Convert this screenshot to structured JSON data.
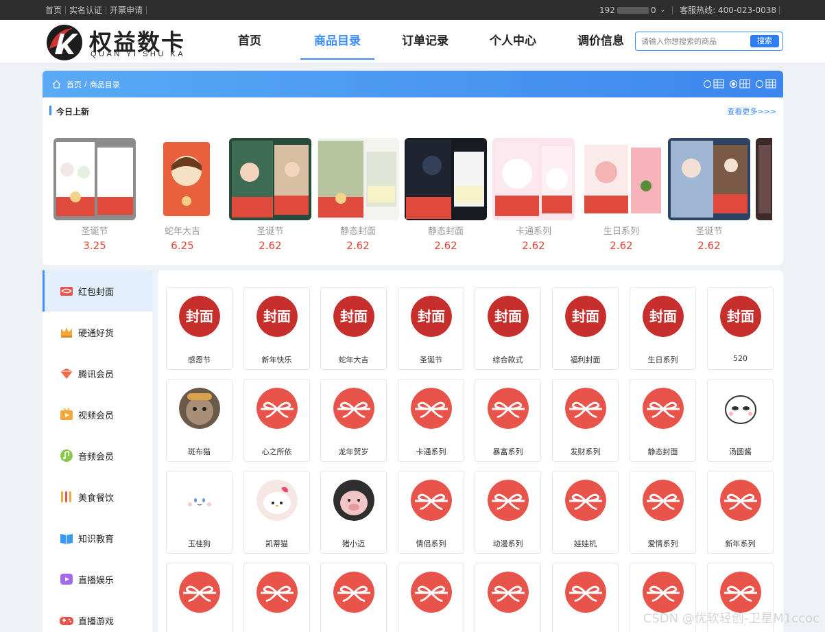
{
  "topbar": {
    "links": [
      "首页",
      "实名认证",
      "开票申请"
    ],
    "phone_prefix": "192",
    "phone_suffix": "0",
    "hotline": "客服热线: 400-023-0038"
  },
  "logo": {
    "title": "权益数卡",
    "subtitle": "QUAN YI SHU KA"
  },
  "nav": [
    "首页",
    "商品目录",
    "订单记录",
    "个人中心",
    "调价信息"
  ],
  "search": {
    "placeholder": "请输入你想搜索的商品",
    "button": "搜索"
  },
  "breadcrumb": {
    "home": "首页",
    "sep": "/",
    "current": "商品目录"
  },
  "today_new": {
    "title": "今日上新",
    "more": "查看更多>>>",
    "items": [
      {
        "name": "圣诞节",
        "price": "3.25"
      },
      {
        "name": "蛇年大吉",
        "price": "6.25"
      },
      {
        "name": "圣诞节",
        "price": "2.62"
      },
      {
        "name": "静态封面",
        "price": "2.62"
      },
      {
        "name": "静态封面",
        "price": "2.62"
      },
      {
        "name": "卡通系列",
        "price": "2.62"
      },
      {
        "name": "生日系列",
        "price": "2.62"
      },
      {
        "name": "圣诞节",
        "price": "2.62"
      }
    ]
  },
  "categories": [
    "红包封面",
    "硬通好货",
    "腾讯会员",
    "视频会员",
    "音频会员",
    "美食餐饮",
    "知识教育",
    "直播娱乐",
    "直播游戏"
  ],
  "products": [
    [
      "感恩节",
      "新年快乐",
      "蛇年大吉",
      "圣诞节",
      "综合款式",
      "福利封面",
      "生日系列",
      "520"
    ],
    [
      "斑布猫",
      "心之所依",
      "龙年贺岁",
      "卡通系列",
      "暴富系列",
      "发财系列",
      "静态封面",
      "汤圆酱"
    ],
    [
      "玉桂狗",
      "凯蒂猫",
      "猪小迈",
      "情侣系列",
      "动漫系列",
      "娃娃机",
      "爱情系列",
      "新年系列"
    ],
    [
      "",
      "",
      "",
      "",
      "",
      "",
      "",
      ""
    ]
  ],
  "cover_label": "封面",
  "watermark": "CSDN @优软轻创-卫星M1ccoc",
  "colors": {
    "accent": "#3a8cff",
    "price": "#e0453b",
    "red_icon": "#e8534a",
    "cover_red": "#c62f2b"
  }
}
